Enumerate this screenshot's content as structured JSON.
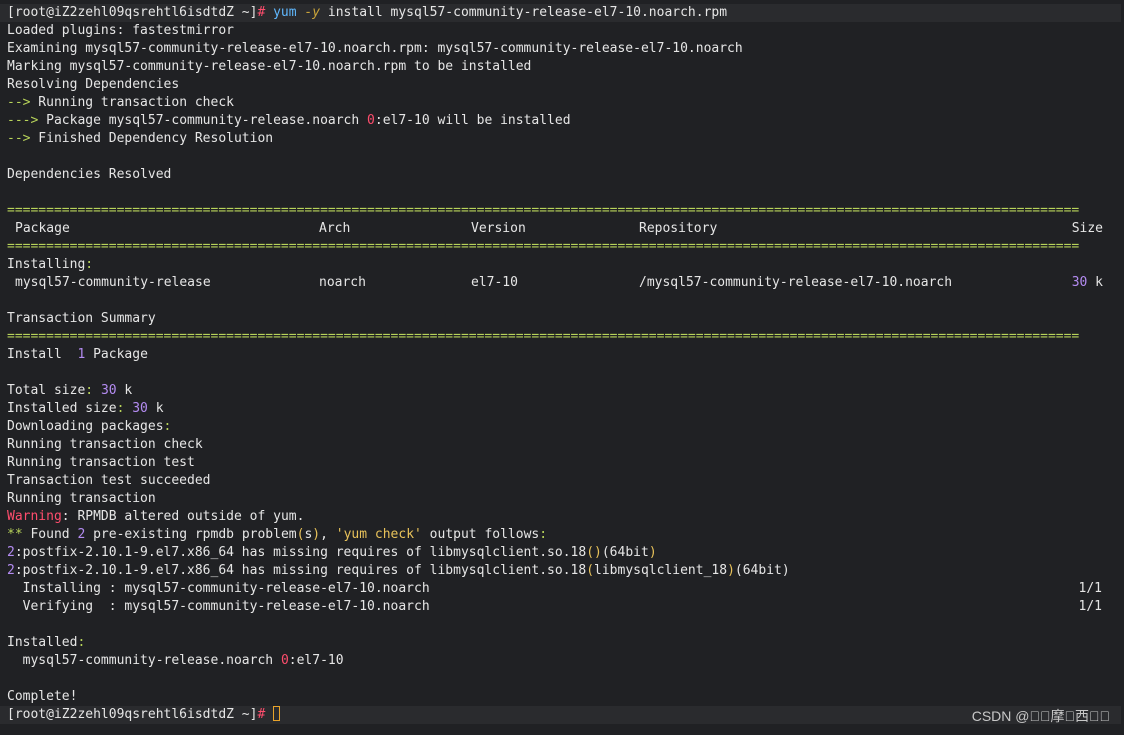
{
  "terminal": {
    "prompt": "[root@iZ2zehl09qsrehtl6isdtdZ ~]",
    "hash": "#",
    "cmd_yum": "yum",
    "cmd_flag": "-y",
    "cmd_rest": "install mysql57-community-release-el7-10.noarch.rpm",
    "lines": {
      "l1": "Loaded plugins: fastestmirror",
      "l2": "Examining mysql57-community-release-el7-10.noarch.rpm: mysql57-community-release-el7-10.noarch",
      "l3": "Marking mysql57-community-release-el7-10.noarch.rpm to be installed",
      "l4": "Resolving Dependencies",
      "l5a": "-->",
      "l5b": " Running transaction check",
      "l6a": "--->",
      "l6b": " Package mysql57-community-release.noarch ",
      "l6c": "0",
      "l6d": ":el7-10 will be installed",
      "l7a": "-->",
      "l7b": " Finished Dependency Resolution",
      "l8": "Dependencies Resolved",
      "eq_rule": "=========================================================================================================================================",
      "installing": "Installing",
      "installing_colon": ":",
      "txn_summary": "Transaction Summary",
      "install_a": "Install  ",
      "install_n": "1",
      "install_b": " Package",
      "total_a": "Total size",
      "total_colon": ":",
      "total_n": "30",
      "total_b": " k",
      "inst_size_a": "Installed size",
      "inst_size_colon": ":",
      "inst_size_n": "30",
      "inst_size_b": " k",
      "downloading_a": "Downloading packages",
      "downloading_colon": ":",
      "run_check": "Running transaction check",
      "run_test": "Running transaction test",
      "test_ok": "Transaction test succeeded",
      "run_txn": "Running transaction",
      "warn_a": "Warning",
      "warn_b": ": RPMDB altered outside of yum.",
      "found_a": "**",
      "found_b": " Found ",
      "found_n": "2",
      "found_c": " pre-existing rpmdb problem",
      "found_d": "(",
      "found_e": "s",
      "found_f": ")",
      "found_g": ", ",
      "found_h": "'yum check'",
      "found_i": " output follows",
      "found_j": ":",
      "p1_n": "2",
      "p1_a": ":postfix-2.10.1-9.el7.x86_64 has missing requires of libmysqlclient.so.18",
      "p1_b": "()",
      "p1_c": "(64bit",
      "p1_d": ")",
      "p2_n": "2",
      "p2_a": ":postfix-2.10.1-9.el7.x86_64 has missing requires of libmysqlclient.so.18",
      "p2_b": "(",
      "p2_c": "libmysqlclient_18",
      "p2_d": ")",
      "p2_e": "(64bit)",
      "installing_step": "  Installing : mysql57-community-release-el7-10.noarch",
      "installing_step_count": "1/1",
      "verifying_step": "  Verifying  : mysql57-community-release-el7-10.noarch",
      "verifying_step_count": "1/1",
      "installed_a": "Installed",
      "installed_colon": ":",
      "installed_pkg_a": "  mysql57-community-release.noarch ",
      "installed_pkg_n": "0",
      "installed_pkg_b": ":el7-10",
      "complete": "Complete!"
    },
    "table": {
      "headers": [
        "Package",
        "Arch",
        "Version",
        "Repository",
        "Size"
      ],
      "row": {
        "package": "mysql57-community-release",
        "arch": "noarch",
        "version": "el7-10",
        "repository": "/mysql57-community-release-el7-10.noarch",
        "size_n": "30",
        "size_u": " k"
      }
    }
  },
  "watermark": "CSDN @\u0000\u0000摩\u0000西\u0000\u0000",
  "colors": {
    "background": "#202124",
    "text": "#e6e6e6",
    "prompt_hash": "#ff4d6d",
    "command": "#5fb8ff",
    "accent_green": "#b8d45a",
    "number_purple": "#b48cf2",
    "warning_red": "#ff4d6d",
    "cursor": "#e8a32a"
  }
}
